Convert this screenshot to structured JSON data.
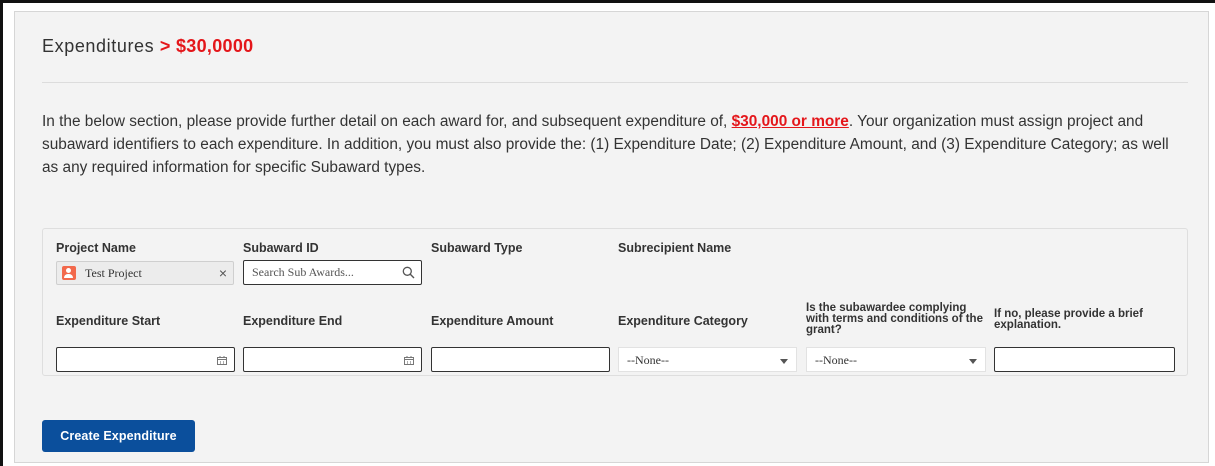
{
  "header": {
    "title": "Expenditures",
    "title_accent": "> $30,0000"
  },
  "intro": {
    "part1": "In the below section, please provide further detail on each award for, and subsequent expenditure of, ",
    "highlight": "$30,000 or more",
    "part2": ". Your organization must assign project and subaward identifiers to each expenditure. In addition, you must also provide the: (1) Expenditure Date; (2) Expenditure Amount, and (3) Expenditure Category; as well as any required information for specific Subaward types."
  },
  "form": {
    "labels": {
      "project_name": "Project Name",
      "subaward_id": "Subaward ID",
      "subaward_type": "Subaward Type",
      "subrecipient_name": "Subrecipient Name",
      "expenditure_start": "Expenditure Start",
      "expenditure_end": "Expenditure End",
      "expenditure_amount": "Expenditure Amount",
      "expenditure_category": "Expenditure Category",
      "complying": "Is the subawardee complying with terms and conditions of the grant?",
      "explanation": "If no, please provide a brief explanation."
    },
    "project_value": "Test Project",
    "subaward_search_placeholder": "Search Sub Awards...",
    "expenditure_start_value": "",
    "expenditure_end_value": "",
    "expenditure_amount_value": "",
    "expenditure_category_selected": "--None--",
    "complying_selected": "--None--",
    "explanation_value": ""
  },
  "actions": {
    "create_label": "Create Expenditure"
  },
  "icons": {
    "project": "project-avatar-icon",
    "clear": "close-icon",
    "search": "search-icon",
    "calendar": "calendar-icon",
    "dropdown": "chevron-down-icon"
  },
  "colors": {
    "accent_red": "#e4161a",
    "primary_button": "#0b4f9c",
    "panel_bg": "#f3f3f3"
  }
}
